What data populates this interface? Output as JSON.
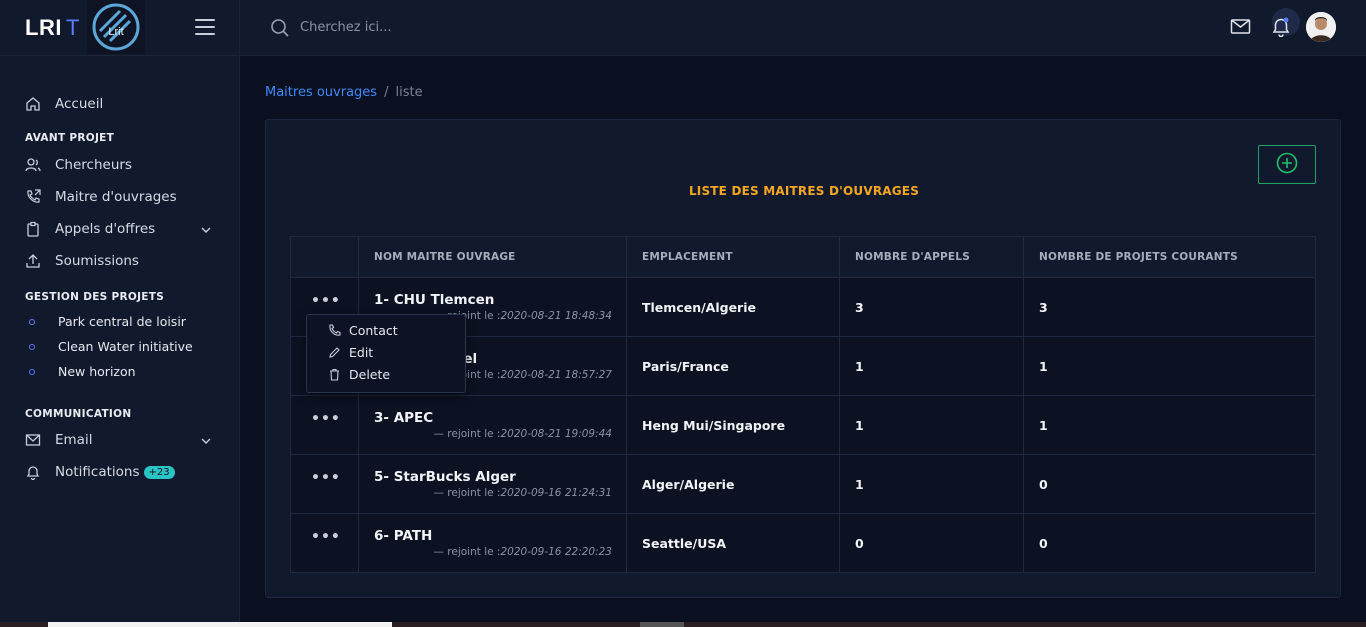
{
  "brand": {
    "name": "LRI",
    "suffix": "T",
    "logo_text": "Lrit"
  },
  "search": {
    "placeholder": "Cherchez ici..."
  },
  "sidebar": {
    "home": "Accueil",
    "sections": [
      {
        "title": "AVANT PROJET"
      },
      {
        "title": "GESTION DES PROJETS"
      },
      {
        "title": "COMMUNICATION"
      }
    ],
    "avant_projet": [
      "Chercheurs",
      "Maitre d'ouvrages",
      "Appels d'offres",
      "Soumissions"
    ],
    "projets": [
      "Park central de loisir",
      "Clean Water initiative",
      "New horizon"
    ],
    "communication": {
      "email": "Email",
      "notifications": "Notifications",
      "notif_badge": "+23"
    }
  },
  "breadcrumb": {
    "link": "Maitres ouvrages",
    "sep": "/",
    "current": "liste"
  },
  "card": {
    "title": "LISTE DES MAITRES D'OUVRAGES"
  },
  "table": {
    "headers": [
      "",
      "NOM MAITRE OUVRAGE",
      "EMPLACEMENT",
      "NOMBRE D'APPELS",
      "NOMBRE DE PROJETS COURANTS"
    ],
    "joined_prefix": "— rejoint le :",
    "rows": [
      {
        "name": "1- CHU Tlemcen",
        "joined": "2020-08-21 18:48:34",
        "location": "Tlemcen/Algerie",
        "appels": "3",
        "projets": "3"
      },
      {
        "name": "2- Paris Hotel",
        "joined": "2020-08-21 18:57:27",
        "location": "Paris/France",
        "appels": "1",
        "projets": "1"
      },
      {
        "name": "3- APEC",
        "joined": "2020-08-21 19:09:44",
        "location": "Heng Mui/Singapore",
        "appels": "1",
        "projets": "1"
      },
      {
        "name": "5- StarBucks Alger",
        "joined": "2020-09-16 21:24:31",
        "location": "Alger/Algerie",
        "appels": "1",
        "projets": "0"
      },
      {
        "name": "6- PATH",
        "joined": "2020-09-16 22:20:23",
        "location": "Seattle/USA",
        "appels": "0",
        "projets": "0"
      }
    ]
  },
  "dropdown": {
    "items": [
      "Contact",
      "Edit",
      "Delete"
    ]
  },
  "colors": {
    "accent": "#3d8bfd",
    "title": "#f5a623",
    "add": "#21a366",
    "badge": "#2bc4c4"
  }
}
